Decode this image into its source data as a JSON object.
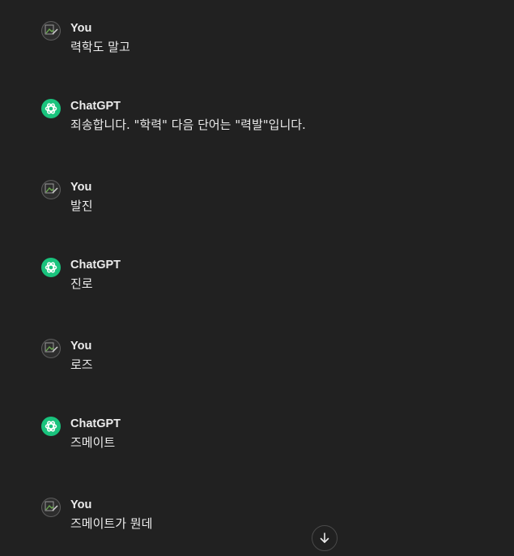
{
  "messages": [
    {
      "role": "user",
      "author": "You",
      "text": "력학도 말고"
    },
    {
      "role": "assistant",
      "author": "ChatGPT",
      "text": "죄송합니다. \"학력\" 다음 단어는 \"력발\"입니다."
    },
    {
      "role": "user",
      "author": "You",
      "text": "발진"
    },
    {
      "role": "assistant",
      "author": "ChatGPT",
      "text": "진로"
    },
    {
      "role": "user",
      "author": "You",
      "text": "로즈"
    },
    {
      "role": "assistant",
      "author": "ChatGPT",
      "text": "즈메이트"
    },
    {
      "role": "user",
      "author": "You",
      "text": "즈메이트가 뭔데"
    }
  ],
  "icons": {
    "user_avatar": "user-avatar-icon",
    "assistant_avatar": "openai-logo-icon",
    "scroll_down": "arrow-down-icon"
  },
  "colors": {
    "background": "#212121",
    "text": "#ececec",
    "assistant_avatar_bg": "#19c37d"
  }
}
